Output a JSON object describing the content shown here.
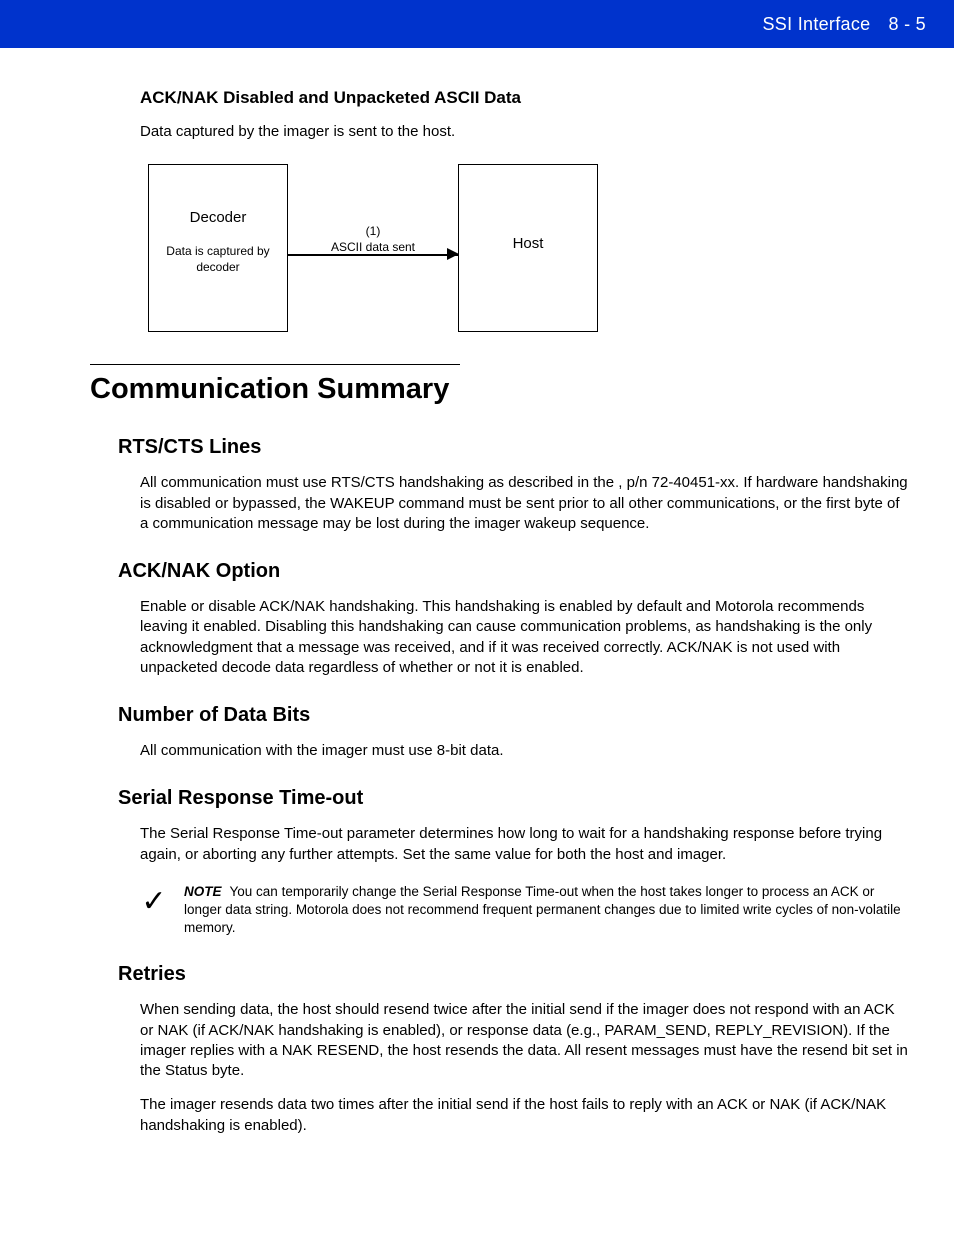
{
  "header": {
    "chapter": "SSI Interface",
    "page": "8 - 5"
  },
  "section1": {
    "title": "ACK/NAK Disabled and Unpacketed ASCII Data",
    "text": "Data captured by the imager is sent to the host.",
    "diagram": {
      "leftTitle": "Decoder",
      "leftSub": "Data is captured by decoder",
      "num": "(1)",
      "label": "ASCII data sent",
      "rightTitle": "Host"
    }
  },
  "mainHeading": "Communication Summary",
  "rts": {
    "title": "RTS/CTS Lines",
    "text": "All communication must use RTS/CTS handshaking as described in the , p/n 72-40451-xx. If hardware handshaking is disabled or bypassed, the WAKEUP command must be sent prior to all other communications, or the first byte of a communication message may be lost during the imager wakeup sequence."
  },
  "ack": {
    "title": "ACK/NAK Option",
    "text": "Enable or disable ACK/NAK handshaking. This handshaking is enabled by default and Motorola recommends leaving it enabled. Disabling this handshaking can cause communication problems, as handshaking is the only acknowledgment that a message was received, and if it was received correctly. ACK/NAK is not used with unpacketed decode data regardless of whether or not it is enabled."
  },
  "bits": {
    "title": "Number of Data Bits",
    "text": "All communication with the imager must use 8-bit data."
  },
  "timeout": {
    "title": "Serial Response Time-out",
    "text": "The Serial Response Time-out parameter determines how long to wait for a handshaking response before trying again, or aborting any further attempts. Set the same value for both the host and imager.",
    "noteLabel": "NOTE",
    "noteText": "You can temporarily change the Serial Response Time-out when the host takes longer to process an ACK or longer data string. Motorola does not recommend frequent permanent changes due to limited write cycles of non-volatile memory."
  },
  "retries": {
    "title": "Retries",
    "p1": "When sending data, the host should resend twice after the initial send if the imager does not respond with an ACK or NAK (if ACK/NAK handshaking is enabled), or response data (e.g., PARAM_SEND, REPLY_REVISION). If the imager replies with a NAK RESEND, the host resends the data. All resent messages must have the resend bit set in the Status byte.",
    "p2": "The imager resends data two times after the initial send if the host fails to reply with an ACK or NAK (if ACK/NAK handshaking is enabled)."
  }
}
